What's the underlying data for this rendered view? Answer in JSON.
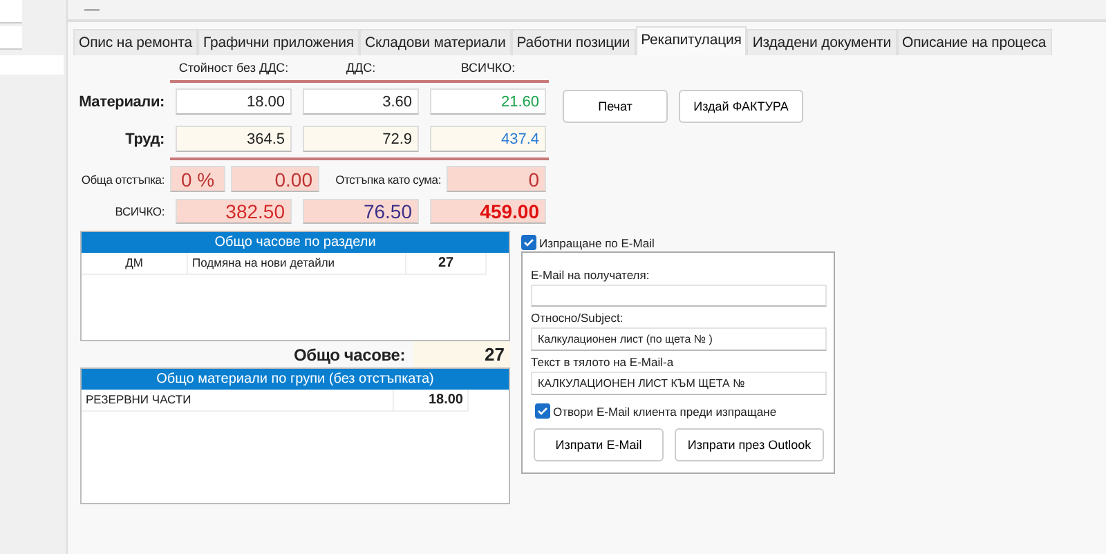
{
  "toolbar": {
    "glyph": "—"
  },
  "tabs": [
    {
      "label": "Опис на ремонта",
      "selected": false
    },
    {
      "label": "Графични приложения",
      "selected": false
    },
    {
      "label": "Складови материали",
      "selected": false
    },
    {
      "label": "Работни позиции",
      "selected": false
    },
    {
      "label": "Рекапитулация",
      "selected": true
    },
    {
      "label": "Издадени документи",
      "selected": false
    },
    {
      "label": "Описание на процеса",
      "selected": false
    }
  ],
  "summary": {
    "headers": [
      "Стойност без ДДС:",
      "ДДС:",
      "ВСИЧКО:"
    ],
    "rows": [
      {
        "label": "Материали:",
        "kind": "main",
        "values": [
          {
            "text": "18.00",
            "color": "#222222"
          },
          {
            "text": "3.60",
            "color": "#222222"
          },
          {
            "text": "21.60",
            "color": "#1aa34a"
          }
        ]
      },
      {
        "label": "Труд:",
        "kind": "labor",
        "values": [
          {
            "text": "364.5",
            "color": "#222222"
          },
          {
            "text": "72.9",
            "color": "#222222"
          },
          {
            "text": "437.4",
            "color": "#2b7bd6"
          }
        ]
      }
    ],
    "discount": {
      "label": "Обща отстъпка:",
      "percent": "0 %",
      "amount": "0.00",
      "sum_label": "Отстъпка като сума:",
      "sum": "0"
    },
    "total": {
      "label": "ВСИЧКО:",
      "values": [
        {
          "text": "382.50",
          "color": "#d42a2a"
        },
        {
          "text": "76.50",
          "color": "#3b2f8a"
        },
        {
          "text": "459.00",
          "color": "#e01010"
        }
      ]
    }
  },
  "buttons": [
    "Печат",
    "Издай ФАКТУРА"
  ],
  "hours_panel": {
    "title": "Общо часове по раздели",
    "rows": [
      {
        "code": "ДМ",
        "name": "Подмяна на нови детайли",
        "hours": "27"
      }
    ]
  },
  "total_hours": {
    "label": "Общо часове:",
    "value": "27"
  },
  "materials_panel": {
    "title": "Общо материали по групи (без отстъпката)",
    "rows": [
      {
        "name": "РЕЗЕРВНИ ЧАСТИ",
        "amount": "18.00"
      }
    ]
  },
  "email": {
    "enabled": {
      "label": "Изпращане по E-Mail",
      "checked": true
    },
    "fields": [
      {
        "label": "E-Mail на получателя:"
      },
      {
        "label": "Относно/Subject:",
        "value": "Калкулационен лист (по щета № )"
      },
      {
        "label": "Текст в тялото на E-Mail-а",
        "value": "КАЛКУЛАЦИОНЕН ЛИСТ КЪМ ЩЕТА №"
      }
    ],
    "open_client": {
      "label": "Отвори E-Mail клиента преди изпращане",
      "checked": true
    },
    "buttons": [
      "Изпрати E-Mail",
      "Изпрати през Outlook"
    ]
  }
}
